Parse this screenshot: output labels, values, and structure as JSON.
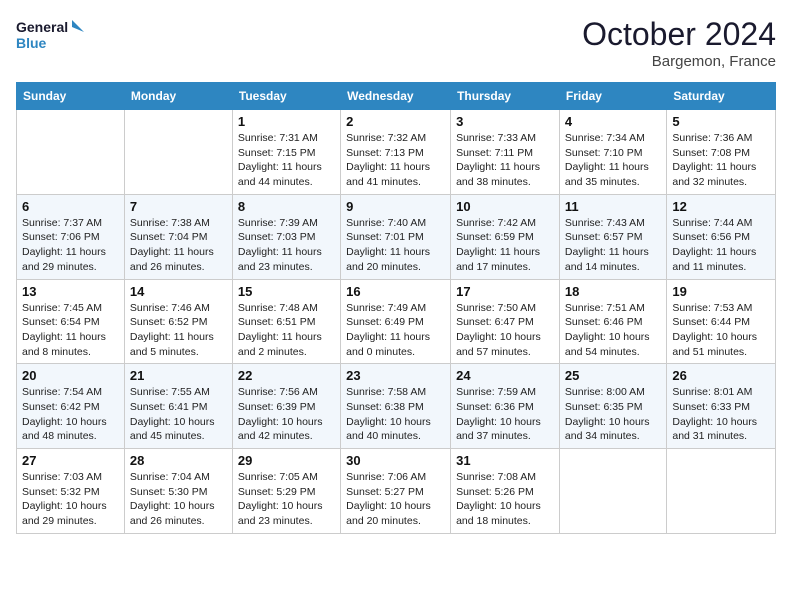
{
  "header": {
    "logo_line1": "General",
    "logo_line2": "Blue",
    "month": "October 2024",
    "location": "Bargemon, France"
  },
  "weekdays": [
    "Sunday",
    "Monday",
    "Tuesday",
    "Wednesday",
    "Thursday",
    "Friday",
    "Saturday"
  ],
  "rows": [
    [
      {
        "day": "",
        "text": ""
      },
      {
        "day": "",
        "text": ""
      },
      {
        "day": "1",
        "text": "Sunrise: 7:31 AM\nSunset: 7:15 PM\nDaylight: 11 hours and 44 minutes."
      },
      {
        "day": "2",
        "text": "Sunrise: 7:32 AM\nSunset: 7:13 PM\nDaylight: 11 hours and 41 minutes."
      },
      {
        "day": "3",
        "text": "Sunrise: 7:33 AM\nSunset: 7:11 PM\nDaylight: 11 hours and 38 minutes."
      },
      {
        "day": "4",
        "text": "Sunrise: 7:34 AM\nSunset: 7:10 PM\nDaylight: 11 hours and 35 minutes."
      },
      {
        "day": "5",
        "text": "Sunrise: 7:36 AM\nSunset: 7:08 PM\nDaylight: 11 hours and 32 minutes."
      }
    ],
    [
      {
        "day": "6",
        "text": "Sunrise: 7:37 AM\nSunset: 7:06 PM\nDaylight: 11 hours and 29 minutes."
      },
      {
        "day": "7",
        "text": "Sunrise: 7:38 AM\nSunset: 7:04 PM\nDaylight: 11 hours and 26 minutes."
      },
      {
        "day": "8",
        "text": "Sunrise: 7:39 AM\nSunset: 7:03 PM\nDaylight: 11 hours and 23 minutes."
      },
      {
        "day": "9",
        "text": "Sunrise: 7:40 AM\nSunset: 7:01 PM\nDaylight: 11 hours and 20 minutes."
      },
      {
        "day": "10",
        "text": "Sunrise: 7:42 AM\nSunset: 6:59 PM\nDaylight: 11 hours and 17 minutes."
      },
      {
        "day": "11",
        "text": "Sunrise: 7:43 AM\nSunset: 6:57 PM\nDaylight: 11 hours and 14 minutes."
      },
      {
        "day": "12",
        "text": "Sunrise: 7:44 AM\nSunset: 6:56 PM\nDaylight: 11 hours and 11 minutes."
      }
    ],
    [
      {
        "day": "13",
        "text": "Sunrise: 7:45 AM\nSunset: 6:54 PM\nDaylight: 11 hours and 8 minutes."
      },
      {
        "day": "14",
        "text": "Sunrise: 7:46 AM\nSunset: 6:52 PM\nDaylight: 11 hours and 5 minutes."
      },
      {
        "day": "15",
        "text": "Sunrise: 7:48 AM\nSunset: 6:51 PM\nDaylight: 11 hours and 2 minutes."
      },
      {
        "day": "16",
        "text": "Sunrise: 7:49 AM\nSunset: 6:49 PM\nDaylight: 11 hours and 0 minutes."
      },
      {
        "day": "17",
        "text": "Sunrise: 7:50 AM\nSunset: 6:47 PM\nDaylight: 10 hours and 57 minutes."
      },
      {
        "day": "18",
        "text": "Sunrise: 7:51 AM\nSunset: 6:46 PM\nDaylight: 10 hours and 54 minutes."
      },
      {
        "day": "19",
        "text": "Sunrise: 7:53 AM\nSunset: 6:44 PM\nDaylight: 10 hours and 51 minutes."
      }
    ],
    [
      {
        "day": "20",
        "text": "Sunrise: 7:54 AM\nSunset: 6:42 PM\nDaylight: 10 hours and 48 minutes."
      },
      {
        "day": "21",
        "text": "Sunrise: 7:55 AM\nSunset: 6:41 PM\nDaylight: 10 hours and 45 minutes."
      },
      {
        "day": "22",
        "text": "Sunrise: 7:56 AM\nSunset: 6:39 PM\nDaylight: 10 hours and 42 minutes."
      },
      {
        "day": "23",
        "text": "Sunrise: 7:58 AM\nSunset: 6:38 PM\nDaylight: 10 hours and 40 minutes."
      },
      {
        "day": "24",
        "text": "Sunrise: 7:59 AM\nSunset: 6:36 PM\nDaylight: 10 hours and 37 minutes."
      },
      {
        "day": "25",
        "text": "Sunrise: 8:00 AM\nSunset: 6:35 PM\nDaylight: 10 hours and 34 minutes."
      },
      {
        "day": "26",
        "text": "Sunrise: 8:01 AM\nSunset: 6:33 PM\nDaylight: 10 hours and 31 minutes."
      }
    ],
    [
      {
        "day": "27",
        "text": "Sunrise: 7:03 AM\nSunset: 5:32 PM\nDaylight: 10 hours and 29 minutes."
      },
      {
        "day": "28",
        "text": "Sunrise: 7:04 AM\nSunset: 5:30 PM\nDaylight: 10 hours and 26 minutes."
      },
      {
        "day": "29",
        "text": "Sunrise: 7:05 AM\nSunset: 5:29 PM\nDaylight: 10 hours and 23 minutes."
      },
      {
        "day": "30",
        "text": "Sunrise: 7:06 AM\nSunset: 5:27 PM\nDaylight: 10 hours and 20 minutes."
      },
      {
        "day": "31",
        "text": "Sunrise: 7:08 AM\nSunset: 5:26 PM\nDaylight: 10 hours and 18 minutes."
      },
      {
        "day": "",
        "text": ""
      },
      {
        "day": "",
        "text": ""
      }
    ]
  ]
}
